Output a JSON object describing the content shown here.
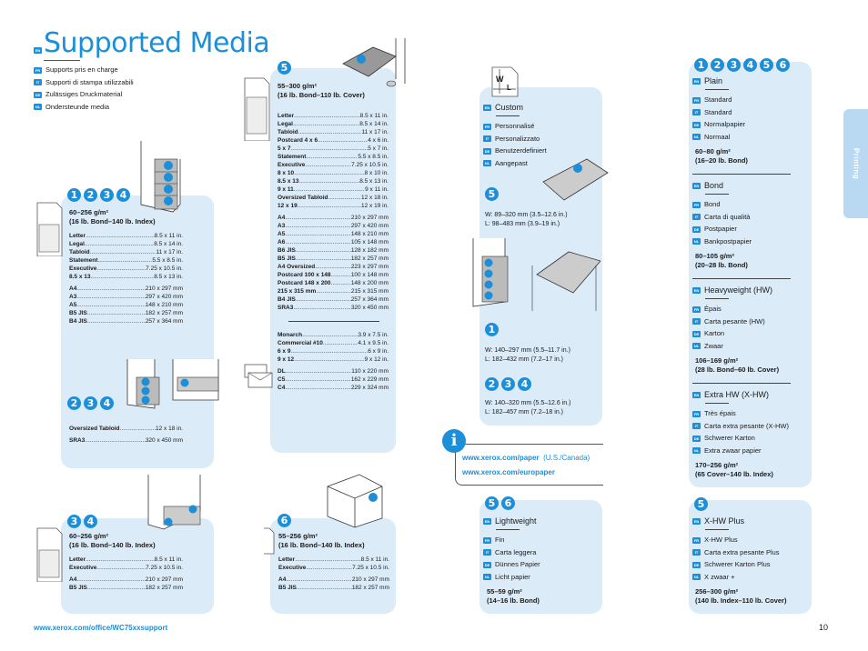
{
  "header": {
    "title": "Supported Media",
    "title_lang": "EN",
    "translations": [
      {
        "lang": "FR",
        "text": "Supports pris en charge"
      },
      {
        "lang": "IT",
        "text": "Supporti di stampa utilizzabili"
      },
      {
        "lang": "DE",
        "text": "Zulässiges Druckmaterial"
      },
      {
        "lang": "NL",
        "text": "Ondersteunde media"
      }
    ]
  },
  "trays_1234": {
    "badges": [
      "1",
      "2",
      "3",
      "4"
    ],
    "weight": "60–256 g/m²",
    "weight_alt": "(16 lb. Bond–140 lb. Index)",
    "sizes_in": [
      {
        "name": "Letter",
        "value": "8.5 x 11 in."
      },
      {
        "name": "Legal",
        "value": "8.5 x 14 in."
      },
      {
        "name": "Tabloid",
        "value": "11 x 17 in."
      },
      {
        "name": "Statement",
        "value": "5.5 x 8.5 in."
      },
      {
        "name": "Executive",
        "value": "7.25 x 10.5 in."
      },
      {
        "name": "8.5 x 13",
        "value": "8.5 x 13 in."
      }
    ],
    "sizes_mm": [
      {
        "name": "A4",
        "value": "210 x 297 mm"
      },
      {
        "name": "A3",
        "value": "297 x 420 mm"
      },
      {
        "name": "A5",
        "value": "148 x 210 mm"
      },
      {
        "name": "B5 JIS",
        "value": "182 x 257 mm"
      },
      {
        "name": "B4 JIS",
        "value": "257 x 364 mm"
      }
    ]
  },
  "trays_234": {
    "badges": [
      "2",
      "3",
      "4"
    ],
    "sizes": [
      {
        "name": "Oversized Tabloid",
        "value": "12 x 18 in."
      },
      {
        "name": "SRA3",
        "value": "320 x 450 mm"
      }
    ]
  },
  "trays_34": {
    "badges": [
      "3",
      "4"
    ],
    "weight": "60–256 g/m²",
    "weight_alt": "(16 lb. Bond–140 lb. Index)",
    "sizes_in": [
      {
        "name": "Letter",
        "value": "8.5 x 11 in."
      },
      {
        "name": "Executive",
        "value": "7.25 x 10.5 in."
      }
    ],
    "sizes_mm": [
      {
        "name": "A4",
        "value": "210 x 297 mm"
      },
      {
        "name": "B5 JIS",
        "value": "182 x 257 mm"
      }
    ]
  },
  "tray_5": {
    "badges": [
      "5"
    ],
    "weight": "55–300 g/m²",
    "weight_alt": "(16 lb. Bond–110 lb. Cover)",
    "sizes_in": [
      {
        "name": "Letter",
        "value": "8.5 x 11 in."
      },
      {
        "name": "Legal",
        "value": "8.5 x 14 in."
      },
      {
        "name": "Tabloid",
        "value": "11 x 17 in."
      },
      {
        "name": "Postcard 4 x 6",
        "value": "4 x 6 in."
      },
      {
        "name": "5 x 7",
        "value": "5 x 7 in."
      },
      {
        "name": "Statement",
        "value": "5.5 x 8.5 in."
      },
      {
        "name": "Executive",
        "value": "7.25 x 10.5 in."
      },
      {
        "name": "8 x 10",
        "value": "8 x 10 in."
      },
      {
        "name": "8.5 x 13",
        "value": "8.5 x 13 in."
      },
      {
        "name": "9 x 11",
        "value": "9 x 11 in."
      },
      {
        "name": "Oversized Tabloid",
        "value": "12 x 18 in."
      },
      {
        "name": "12 x 19",
        "value": "12 x 19 in."
      }
    ],
    "sizes_mm": [
      {
        "name": "A4",
        "value": "210 x 297 mm"
      },
      {
        "name": "A3",
        "value": "297 x 420 mm"
      },
      {
        "name": "A5",
        "value": "148 x 210 mm"
      },
      {
        "name": "A6",
        "value": "105 x 148 mm"
      },
      {
        "name": "B6 JIS",
        "value": "128 x 182 mm"
      },
      {
        "name": "B5 JIS",
        "value": "182 x 257 mm"
      },
      {
        "name": "A4 Oversized",
        "value": "223 x 297 mm"
      },
      {
        "name": "Postcard 100 x 148",
        "value": "100 x 148 mm"
      },
      {
        "name": "Postcard 148 x 200",
        "value": "148 x 200 mm"
      },
      {
        "name": "215 x 315 mm",
        "value": "215 x 315 mm"
      },
      {
        "name": "B4 JIS",
        "value": "257 x 364 mm"
      },
      {
        "name": "SRA3",
        "value": "320 x 450 mm"
      }
    ],
    "envelopes_in": [
      {
        "name": "Monarch",
        "value": "3.9 x 7.5 in."
      },
      {
        "name": "Commercial #10",
        "value": "4.1 x 9.5 in."
      },
      {
        "name": "6 x 9",
        "value": "6 x 9 in."
      },
      {
        "name": "9 x 12",
        "value": "9 x 12 in."
      }
    ],
    "envelopes_mm": [
      {
        "name": "DL",
        "value": "110 x 220 mm"
      },
      {
        "name": "C5",
        "value": "162 x 229 mm"
      },
      {
        "name": "C4",
        "value": "229 x 324 mm"
      }
    ]
  },
  "tray_6": {
    "badges": [
      "6"
    ],
    "weight": "55–256 g/m²",
    "weight_alt": "(16 lb. Bond–140 lb. Index)",
    "sizes_in": [
      {
        "name": "Letter",
        "value": "8.5 x 11 in."
      },
      {
        "name": "Executive",
        "value": "7.25 x 10.5 in."
      }
    ],
    "sizes_mm": [
      {
        "name": "A4",
        "value": "210 x 297 mm"
      },
      {
        "name": "B5 JIS",
        "value": "182 x 257 mm"
      }
    ]
  },
  "custom": {
    "icon_w": "W",
    "icon_l": "L",
    "title": "Custom",
    "translations": [
      {
        "lang": "FR",
        "text": "Personnalisé"
      },
      {
        "lang": "IT",
        "text": "Personalizzato"
      },
      {
        "lang": "DE",
        "text": "Benutzerdefiniert"
      },
      {
        "lang": "NL",
        "text": "Aangepast"
      }
    ],
    "groups": [
      {
        "badges": [
          "5"
        ],
        "w": "W: 89–320 mm (3.5–12.6 in.)",
        "l": "L: 98–483 mm (3.9–19 in.)"
      },
      {
        "badges": [
          "1"
        ],
        "w": "W: 140–297 mm (5.5–11.7 in.)",
        "l": "L: 182–432 mm (7.2–17 in.)"
      },
      {
        "badges": [
          "2",
          "3",
          "4"
        ],
        "w": "W: 140–320 mm (5.5–12.6 in.)",
        "l": "L: 182–457 mm (7.2–18 in.)"
      }
    ]
  },
  "info": {
    "links": [
      {
        "url": "www.xerox.com/paper",
        "note": "(U.S./Canada)"
      },
      {
        "url": "www.xerox.com/europaper",
        "note": ""
      }
    ]
  },
  "lightweight": {
    "badges": [
      "5",
      "6"
    ],
    "title": "Lightweight",
    "translations": [
      {
        "lang": "FR",
        "text": "Fin"
      },
      {
        "lang": "IT",
        "text": "Carta leggera"
      },
      {
        "lang": "DE",
        "text": "Dünnes Papier"
      },
      {
        "lang": "NL",
        "text": "Licht papier"
      }
    ],
    "weight": "55–59 g/m²",
    "weight_alt": "(14–16 lb. Bond)"
  },
  "media_types": {
    "badges": [
      "1",
      "2",
      "3",
      "4",
      "5",
      "6"
    ],
    "items": [
      {
        "title": "Plain",
        "translations": [
          {
            "lang": "FR",
            "text": "Standard"
          },
          {
            "lang": "IT",
            "text": "Standard"
          },
          {
            "lang": "DE",
            "text": "Normalpapier"
          },
          {
            "lang": "NL",
            "text": "Normaal"
          }
        ],
        "weight": "60–80 g/m²",
        "weight_alt": "(16–20 lb. Bond)"
      },
      {
        "title": "Bond",
        "translations": [
          {
            "lang": "FR",
            "text": "Bond"
          },
          {
            "lang": "IT",
            "text": "Carta di qualità"
          },
          {
            "lang": "DE",
            "text": "Postpapier"
          },
          {
            "lang": "NL",
            "text": "Bankpostpapier"
          }
        ],
        "weight": "80–105 g/m²",
        "weight_alt": "(20–28 lb. Bond)"
      },
      {
        "title": "Heavyweight (HW)",
        "translations": [
          {
            "lang": "FR",
            "text": "Épais"
          },
          {
            "lang": "IT",
            "text": "Carta pesante (HW)"
          },
          {
            "lang": "DE",
            "text": "Karton"
          },
          {
            "lang": "NL",
            "text": "Zwaar"
          }
        ],
        "weight": "106–169 g/m²",
        "weight_alt": "(28 lb. Bond–60 lb. Cover)"
      },
      {
        "title": "Extra HW (X-HW)",
        "translations": [
          {
            "lang": "FR",
            "text": "Très épais"
          },
          {
            "lang": "IT",
            "text": "Carta extra pesante (X-HW)"
          },
          {
            "lang": "DE",
            "text": "Schwerer Karton"
          },
          {
            "lang": "NL",
            "text": "Extra zwaar papier"
          }
        ],
        "weight": "170–256 g/m²",
        "weight_alt": "(65 Cover–140 lb. Index)"
      }
    ]
  },
  "xhw_plus": {
    "badges": [
      "5"
    ],
    "title": "X-HW Plus",
    "translations": [
      {
        "lang": "FR",
        "text": "X-HW Plus"
      },
      {
        "lang": "IT",
        "text": "Carta extra pesante Plus"
      },
      {
        "lang": "DE",
        "text": "Schwerer Karton Plus"
      },
      {
        "lang": "NL",
        "text": "X zwaar +"
      }
    ],
    "weight": "256–300 g/m²",
    "weight_alt": "(140 lb. Index–110 lb. Cover)"
  },
  "side_tab": "Printing",
  "footer": {
    "url": "www.xerox.com/office/WC75xxsupport",
    "page": "10"
  },
  "colors": {
    "accent": "#1c8fd8",
    "panel": "#dcebf8",
    "side_tab": "#b9d8f2"
  }
}
